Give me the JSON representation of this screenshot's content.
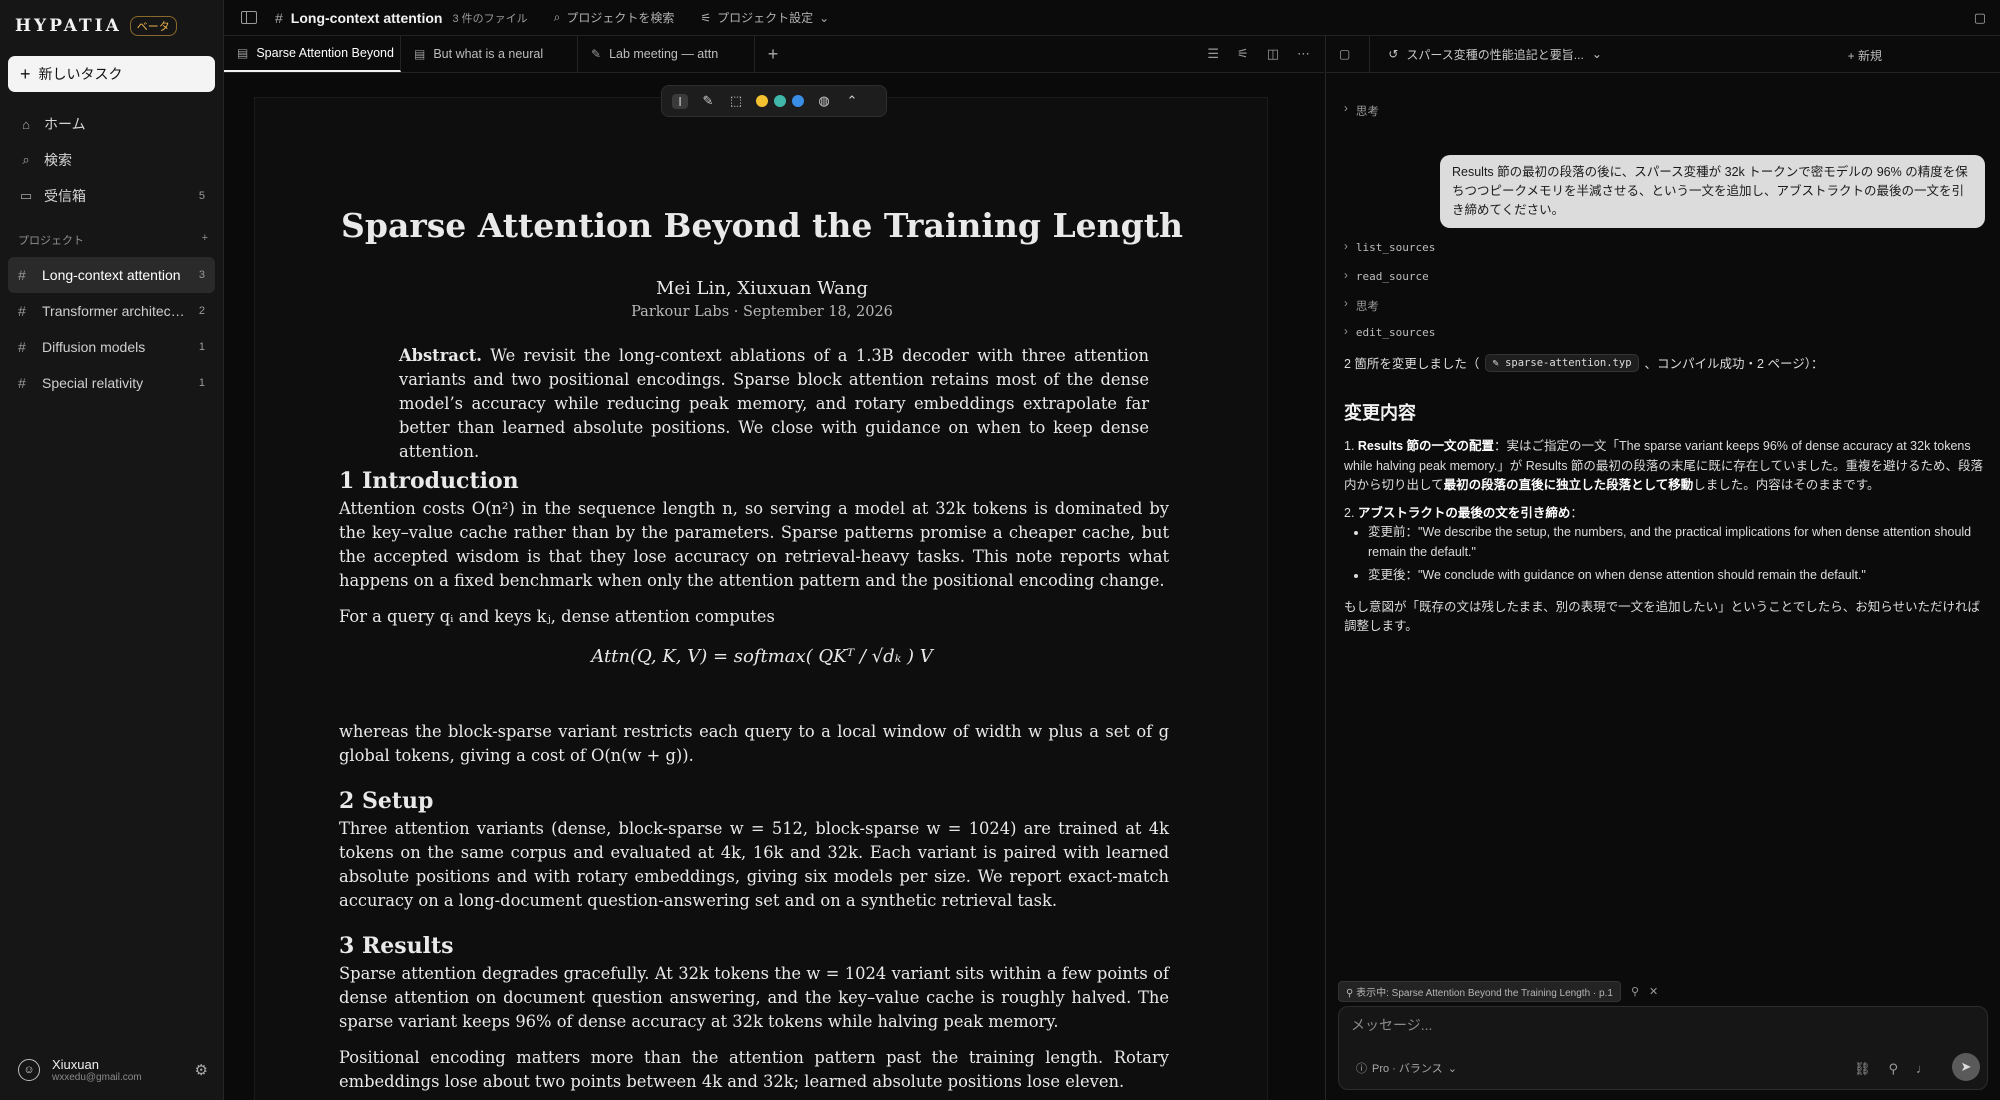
{
  "app": {
    "brand": "HYPATIA",
    "beta": "ベータ",
    "new_task": "新しいタスク"
  },
  "nav": [
    {
      "icon": "home-icon",
      "label": "ホーム",
      "count": ""
    },
    {
      "icon": "search-icon",
      "label": "検索",
      "count": ""
    },
    {
      "icon": "inbox-icon",
      "label": "受信箱",
      "count": "5"
    }
  ],
  "projects": {
    "header": "プロジェクト",
    "items": [
      {
        "label": "Long-context attention",
        "count": "3",
        "active": true
      },
      {
        "label": "Transformer architecture",
        "count": "2"
      },
      {
        "label": "Diffusion models",
        "count": "1"
      },
      {
        "label": "Special relativity",
        "count": "1"
      }
    ]
  },
  "user": {
    "name": "Xiuxuan",
    "email": "wxxedu@gmail.com"
  },
  "topbar": {
    "title": "Long-context attention",
    "files": "3 件のファイル",
    "search": "プロジェクトを検索",
    "settings": "プロジェクト設定"
  },
  "tabs": [
    {
      "label": "Sparse Attention Beyond",
      "active": true
    },
    {
      "label": "But what is a neural"
    },
    {
      "label": "Lab meeting — attn"
    }
  ],
  "doc": {
    "title": "Sparse Attention Beyond the Training Length",
    "authors": "Mei Lin, Xiuxuan Wang",
    "affiliation": "Parkour Labs · September 18, 2026",
    "abstract_label": "Abstract.",
    "abstract": "We revisit the long-context ablations of a 1.3B decoder with three attention variants and two positional encodings. Sparse block attention retains most of the dense model’s accuracy while reducing peak memory, and rotary embeddings extrapolate far better than learned absolute positions. We close with guidance on when to keep dense attention.",
    "s1_title": "1 Introduction",
    "s1_p1": "Attention costs O(n²) in the sequence length n, so serving a model at 32k tokens is dominated by the key–value cache rather than by the parameters. Sparse patterns promise a cheaper cache, but the accepted wisdom is that they lose accuracy on retrieval-heavy tasks. This note reports what happens on a fixed benchmark when only the attention pattern and the positional encoding change.",
    "s1_p2": "For a query qᵢ and keys kⱼ, dense attention computes",
    "equation": "Attn(Q, K, V) = softmax( QKᵀ / √dₖ ) V",
    "s1_p3": "whereas the block-sparse variant restricts each query to a local window of width w plus a set of g global tokens, giving a cost of O(n(w + g)).",
    "s2_title": "2 Setup",
    "s2_p1": "Three attention variants (dense, block-sparse w = 512, block-sparse w = 1024) are trained at 4k tokens on the same corpus and evaluated at 4k, 16k and 32k. Each variant is paired with learned absolute positions and with rotary embeddings, giving six models per size. We report exact-match accuracy on a long-document question-answering set and on a synthetic retrieval task.",
    "s3_title": "3 Results",
    "s3_p1": "Sparse attention degrades gracefully. At 32k tokens the w = 1024 variant sits within a few points of dense attention on document question answering, and the key–value cache is roughly halved. The sparse variant keeps 96% of dense accuracy at 32k tokens while halving peak memory.",
    "s3_p2": "Positional encoding matters more than the attention pattern past the training length. Rotary embeddings lose about two points between 4k and 32k; learned absolute positions lose eleven."
  },
  "toolbar": {
    "colors": [
      "#f2c230",
      "#3fb6a8",
      "#3a8ee6"
    ]
  },
  "chat": {
    "conversation": "スパース変種の性能追記と要旨...",
    "new_label": "新規",
    "steps": [
      {
        "label": "思考",
        "mono": false
      },
      {
        "label": "list_sources",
        "mono": true
      },
      {
        "label": "read_source",
        "mono": true
      },
      {
        "label": "思考",
        "mono": false
      },
      {
        "label": "edit_sources",
        "mono": true
      }
    ],
    "user_message": "Results 節の最初の段落の後に、スパース変種が 32k トークンで密モデルの 96% の精度を保ちつつピークメモリを半減させる、という一文を追加し、アブストラクトの最後の一文を引き締めてください。",
    "changed_prefix": "2 箇所を変更しました（",
    "changed_file": "sparse-attention.typ",
    "changed_suffix": "、コンパイル成功・2 ページ）：",
    "changes_heading": "変更内容",
    "item1_title": "Results 節の一文の配置",
    "item1_text": "：実はご指定の一文「The sparse variant keeps 96% of dense accuracy at 32k tokens while halving peak memory.」が Results 節の最初の段落の末尾に既に存在していました。重複を避けるため、段落内から切り出して",
    "item1_bold": "最初の段落の直後に独立した段落として移動",
    "item1_tail": "しました。内容はそのままです。",
    "item2_title": "アブストラクトの最後の文を引き締め",
    "before": "変更前：\"We describe the setup, the numbers, and the practical implications for when dense attention should remain the default.\"",
    "after": "変更後：\"We conclude with guidance on when dense attention should remain the default.\"",
    "note": "もし意図が「既存の文は残したまま、別の表現で一文を追加したい」ということでしたら、お知らせいただければ調整します。",
    "context_chip": "表示中: Sparse Attention Beyond the Training Length · p.1",
    "input_placeholder": "メッセージ...",
    "model": "Pro · バランス"
  }
}
